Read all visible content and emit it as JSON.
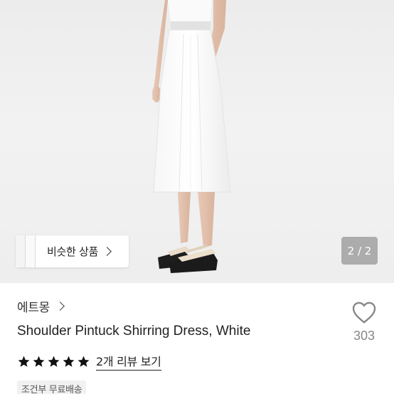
{
  "product_image": {
    "counter": "2 / 2",
    "similar_button_label": "비슷한 상품"
  },
  "product": {
    "brand": "에트몽",
    "title": "Shoulder Pintuck Shirring Dress, White",
    "rating_stars": 5,
    "review_link": "2개 리뷰 보기",
    "shipping_badge": "조건부 무료배송"
  },
  "like": {
    "count": "303"
  },
  "colors": {
    "star": "#111111",
    "like_outline": "#888888",
    "badge_bg": "#f1f1f1"
  },
  "icons": [
    "chevron-right-icon",
    "star-icon",
    "heart-outline-icon"
  ]
}
